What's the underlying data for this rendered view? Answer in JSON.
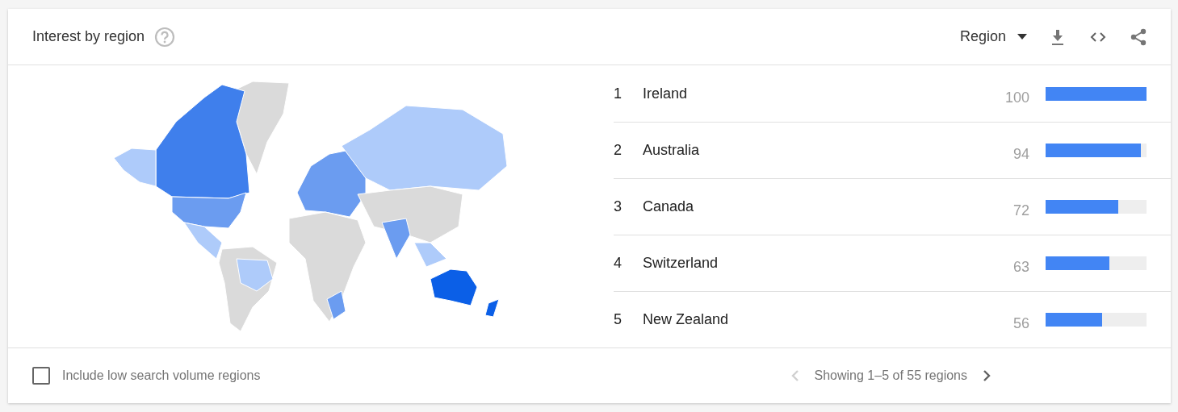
{
  "header": {
    "title": "Interest by region",
    "region_select": {
      "value": "Region"
    }
  },
  "regions": [
    {
      "rank": "1",
      "name": "Ireland",
      "value": "100",
      "level": 1.0
    },
    {
      "rank": "2",
      "name": "Australia",
      "value": "94",
      "level": 0.94
    },
    {
      "rank": "3",
      "name": "Canada",
      "value": "72",
      "level": 0.72
    },
    {
      "rank": "4",
      "name": "Switzerland",
      "value": "63",
      "level": 0.63
    },
    {
      "rank": "5",
      "name": "New Zealand",
      "value": "56",
      "level": 0.56
    }
  ],
  "footer": {
    "low_volume": {
      "label": "Include low search volume regions",
      "checked": false
    },
    "pagination": {
      "text": "Showing 1–5 of 55 regions",
      "prev_disabled": true,
      "next_disabled": false
    }
  }
}
